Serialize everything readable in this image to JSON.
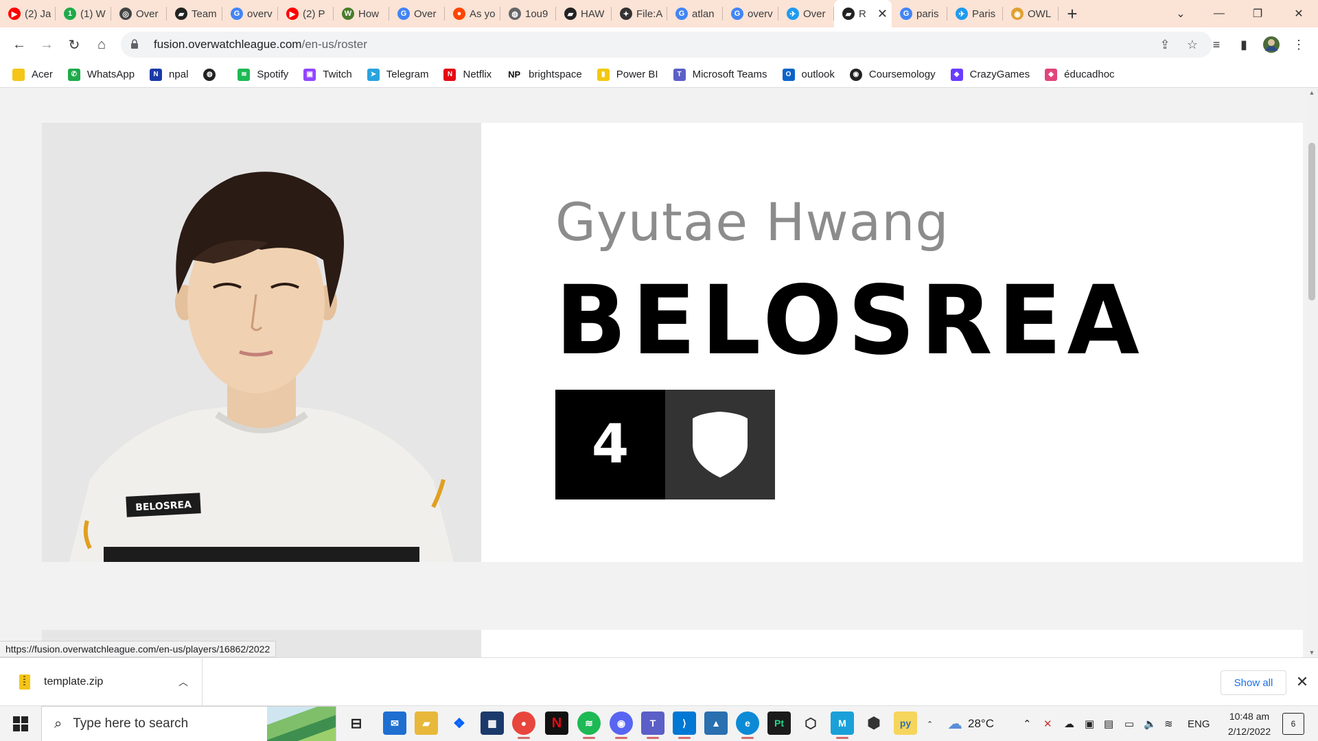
{
  "browser": {
    "tabs": [
      {
        "title": "(2) Ja",
        "icon": "youtube-icon",
        "color": "#ff0000"
      },
      {
        "title": "(1) W",
        "icon": "green-circle-icon",
        "color": "#1faa4a"
      },
      {
        "title": "Over",
        "icon": "overwatch-icon",
        "color": "#444444"
      },
      {
        "title": "Team",
        "icon": "owl-flag-icon",
        "color": "#222222"
      },
      {
        "title": "overv",
        "icon": "google-icon",
        "color": "#4285f4"
      },
      {
        "title": "(2) P",
        "icon": "youtube-icon",
        "color": "#ff0000"
      },
      {
        "title": "How",
        "icon": "wikihow-icon",
        "color": "#4a7c2b"
      },
      {
        "title": "Over",
        "icon": "google-icon",
        "color": "#4285f4"
      },
      {
        "title": "As yo",
        "icon": "reddit-icon",
        "color": "#ff4500"
      },
      {
        "title": "1ou9",
        "icon": "globe-icon",
        "color": "#666666"
      },
      {
        "title": "HAW",
        "icon": "owl-flag-icon",
        "color": "#222222"
      },
      {
        "title": "File:A",
        "icon": "wikimedia-icon",
        "color": "#333333"
      },
      {
        "title": "atlan",
        "icon": "google-icon",
        "color": "#4285f4"
      },
      {
        "title": "overv",
        "icon": "google-icon",
        "color": "#4285f4"
      },
      {
        "title": "Over",
        "icon": "twitter-icon",
        "color": "#1d9bf0"
      },
      {
        "title": "R",
        "icon": "owl-flag-icon",
        "color": "#222222",
        "active": true
      },
      {
        "title": "paris",
        "icon": "google-icon",
        "color": "#4285f4"
      },
      {
        "title": "Paris",
        "icon": "twitter-icon",
        "color": "#1d9bf0"
      },
      {
        "title": "OWL",
        "icon": "owl-coin-icon",
        "color": "#e0a030"
      }
    ],
    "address": {
      "host": "fusion.overwatchleague.com",
      "path": "/en-us/roster"
    },
    "bookmarks": [
      {
        "label": "Acer",
        "icon": "folder-icon",
        "color": "#f5c518"
      },
      {
        "label": "WhatsApp",
        "icon": "whatsapp-icon",
        "color": "#1faa4a"
      },
      {
        "label": "npal",
        "icon": "npal-icon",
        "color": "#1b3aa8"
      },
      {
        "label": "",
        "icon": "globe-icon",
        "color": "#222222"
      },
      {
        "label": "Spotify",
        "icon": "spotify-icon",
        "color": "#1db954"
      },
      {
        "label": "Twitch",
        "icon": "twitch-icon",
        "color": "#9146ff"
      },
      {
        "label": "Telegram",
        "icon": "telegram-icon",
        "color": "#2aa3df"
      },
      {
        "label": "Netflix",
        "icon": "netflix-icon",
        "color": "#e50914"
      },
      {
        "label": "brightspace",
        "icon": "np-icon",
        "color": "#111111",
        "badge": "NP"
      },
      {
        "label": "Power BI",
        "icon": "powerbi-icon",
        "color": "#f2c811"
      },
      {
        "label": "Microsoft Teams",
        "icon": "teams-icon",
        "color": "#5b5fc7"
      },
      {
        "label": "outlook",
        "icon": "outlook-icon",
        "color": "#0a64c8"
      },
      {
        "label": "Coursemology",
        "icon": "coursemology-icon",
        "color": "#222222"
      },
      {
        "label": "CrazyGames",
        "icon": "crazygames-icon",
        "color": "#6a3cff"
      },
      {
        "label": "éducadhoc",
        "icon": "educadhoc-icon",
        "color": "#e0457b"
      }
    ],
    "status_url": "https://fusion.overwatchleague.com/en-us/players/16862/2022"
  },
  "player": {
    "real_name": "Gyutae Hwang",
    "gamertag": "BELOSREA",
    "number": "4",
    "role_icon": "support-shield-icon",
    "jersey_text": "BELOSREA"
  },
  "downloads": {
    "file_name": "template.zip",
    "show_all_label": "Show all"
  },
  "taskbar": {
    "search_placeholder": "Type here to search",
    "weather": "28°C",
    "language": "ENG",
    "time": "10:48 am",
    "date": "2/12/2022",
    "notification_count": "6"
  }
}
